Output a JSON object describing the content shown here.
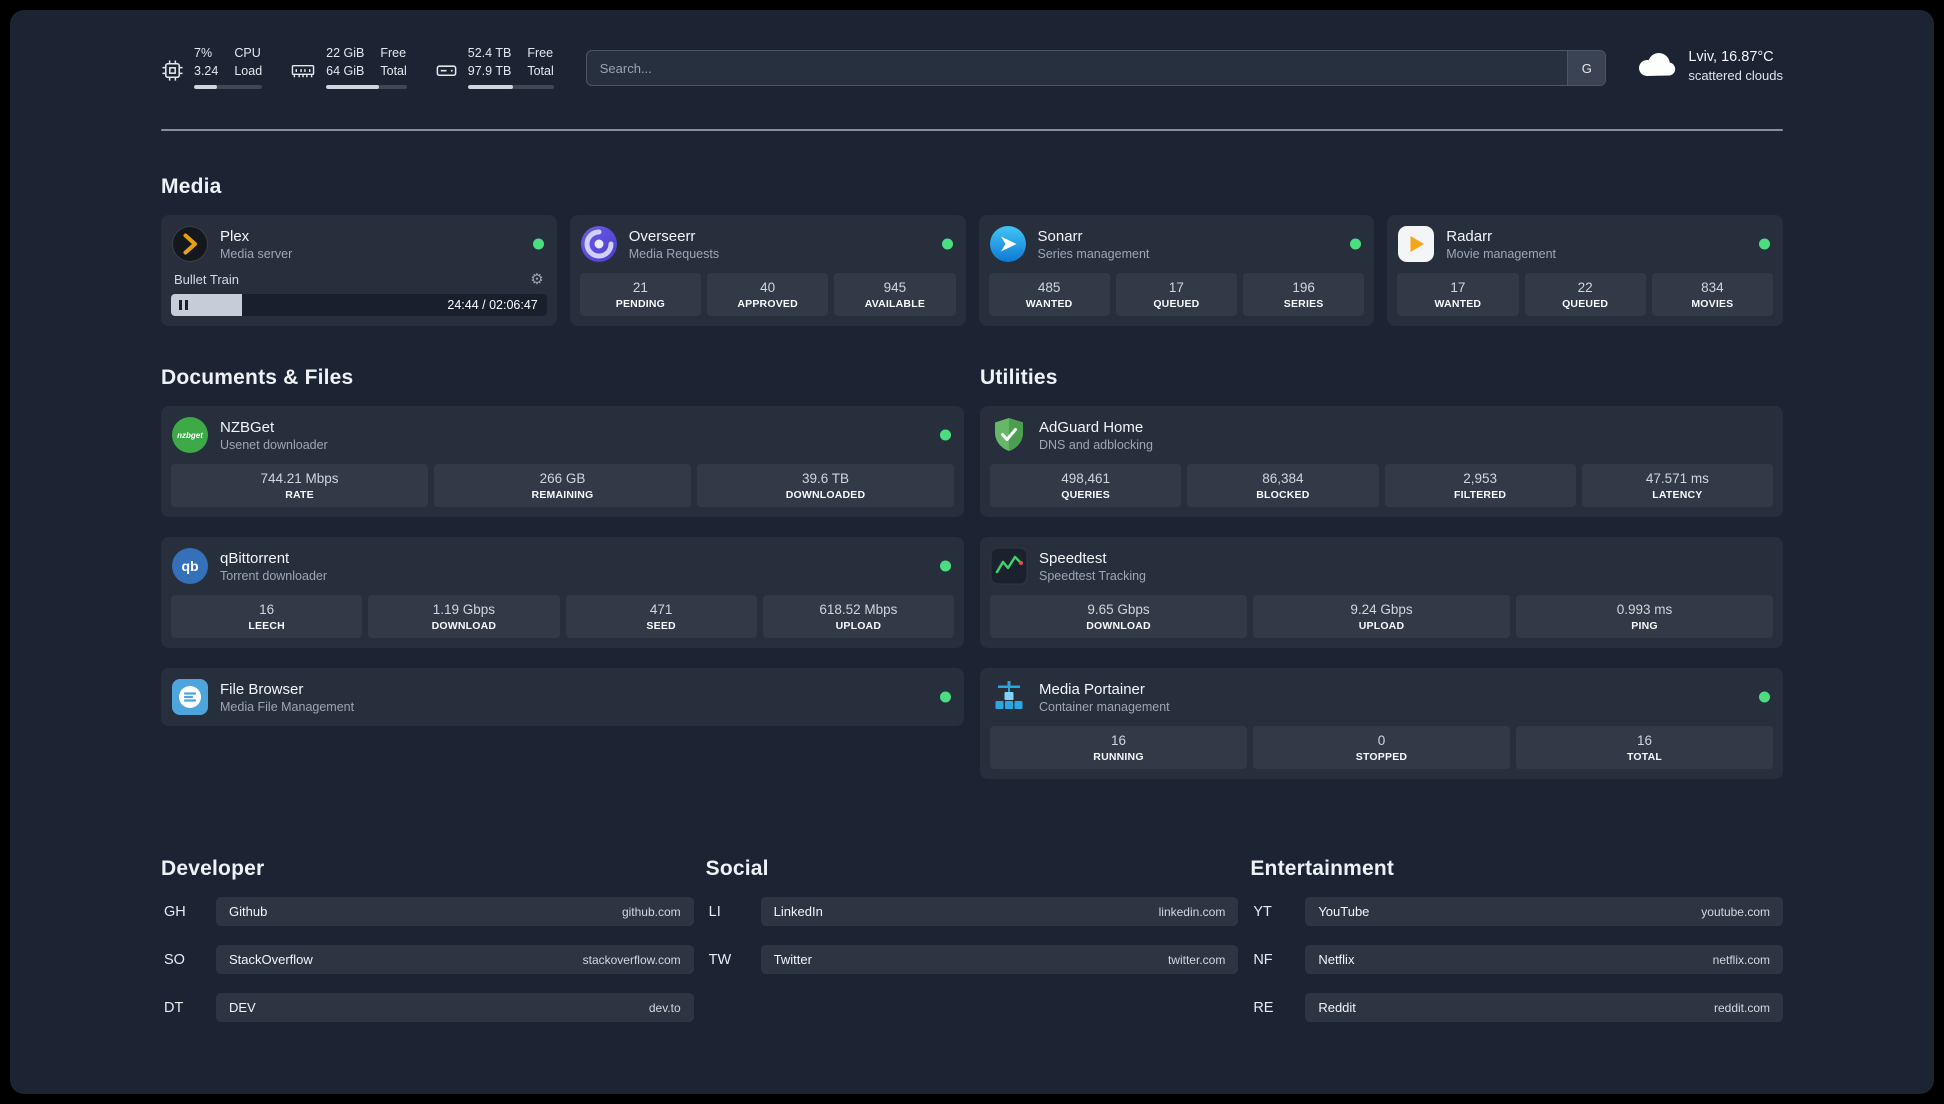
{
  "topbar": {
    "cpu": {
      "percent": "7%",
      "load": "3.24",
      "row1_label": "CPU",
      "row2_label": "Load",
      "bar_percent": 34
    },
    "memory": {
      "row1_value": "22 GiB",
      "row2_value": "64 GiB",
      "row1_label": "Free",
      "row2_label": "Total",
      "bar_percent": 66
    },
    "disk": {
      "row1_value": "52.4 TB",
      "row2_value": "97.9 TB",
      "row1_label": "Free",
      "row2_label": "Total",
      "bar_percent": 53
    },
    "search": {
      "placeholder": "Search...",
      "button_label": "G"
    },
    "weather": {
      "location": "Lviv, 16.87°C",
      "condition": "scattered clouds"
    }
  },
  "sections": {
    "media": "Media",
    "documents": "Documents & Files",
    "utilities": "Utilities",
    "developer": "Developer",
    "social": "Social",
    "entertainment": "Entertainment"
  },
  "services": {
    "plex": {
      "name": "Plex",
      "subtitle": "Media server",
      "now_playing": "Bullet Train",
      "time": "24:44 / 02:06:47",
      "progress_percent": 19
    },
    "overseerr": {
      "name": "Overseerr",
      "subtitle": "Media Requests",
      "stats": [
        {
          "value": "21",
          "label": "PENDING"
        },
        {
          "value": "40",
          "label": "APPROVED"
        },
        {
          "value": "945",
          "label": "AVAILABLE"
        }
      ]
    },
    "sonarr": {
      "name": "Sonarr",
      "subtitle": "Series management",
      "stats": [
        {
          "value": "485",
          "label": "WANTED"
        },
        {
          "value": "17",
          "label": "QUEUED"
        },
        {
          "value": "196",
          "label": "SERIES"
        }
      ]
    },
    "radarr": {
      "name": "Radarr",
      "subtitle": "Movie management",
      "stats": [
        {
          "value": "17",
          "label": "WANTED"
        },
        {
          "value": "22",
          "label": "QUEUED"
        },
        {
          "value": "834",
          "label": "MOVIES"
        }
      ]
    },
    "nzbget": {
      "name": "NZBGet",
      "subtitle": "Usenet downloader",
      "stats": [
        {
          "value": "744.21 Mbps",
          "label": "RATE"
        },
        {
          "value": "266 GB",
          "label": "REMAINING"
        },
        {
          "value": "39.6 TB",
          "label": "DOWNLOADED"
        }
      ]
    },
    "qbittorrent": {
      "name": "qBittorrent",
      "subtitle": "Torrent downloader",
      "stats": [
        {
          "value": "16",
          "label": "LEECH"
        },
        {
          "value": "1.19 Gbps",
          "label": "DOWNLOAD"
        },
        {
          "value": "471",
          "label": "SEED"
        },
        {
          "value": "618.52 Mbps",
          "label": "UPLOAD"
        }
      ]
    },
    "filebrowser": {
      "name": "File Browser",
      "subtitle": "Media File Management"
    },
    "adguard": {
      "name": "AdGuard Home",
      "subtitle": "DNS and adblocking",
      "stats": [
        {
          "value": "498,461",
          "label": "QUERIES"
        },
        {
          "value": "86,384",
          "label": "BLOCKED"
        },
        {
          "value": "2,953",
          "label": "FILTERED"
        },
        {
          "value": "47.571 ms",
          "label": "LATENCY"
        }
      ]
    },
    "speedtest": {
      "name": "Speedtest",
      "subtitle": "Speedtest Tracking",
      "stats": [
        {
          "value": "9.65 Gbps",
          "label": "DOWNLOAD"
        },
        {
          "value": "9.24 Gbps",
          "label": "UPLOAD"
        },
        {
          "value": "0.993 ms",
          "label": "PING"
        }
      ]
    },
    "portainer": {
      "name": "Media Portainer",
      "subtitle": "Container management",
      "stats": [
        {
          "value": "16",
          "label": "RUNNING"
        },
        {
          "value": "0",
          "label": "STOPPED"
        },
        {
          "value": "16",
          "label": "TOTAL"
        }
      ]
    }
  },
  "bookmarks": {
    "developer": [
      {
        "abbr": "GH",
        "name": "Github",
        "url": "github.com"
      },
      {
        "abbr": "SO",
        "name": "StackOverflow",
        "url": "stackoverflow.com"
      },
      {
        "abbr": "DT",
        "name": "DEV",
        "url": "dev.to"
      }
    ],
    "social": [
      {
        "abbr": "LI",
        "name": "LinkedIn",
        "url": "linkedin.com"
      },
      {
        "abbr": "TW",
        "name": "Twitter",
        "url": "twitter.com"
      }
    ],
    "entertainment": [
      {
        "abbr": "YT",
        "name": "YouTube",
        "url": "youtube.com"
      },
      {
        "abbr": "NF",
        "name": "Netflix",
        "url": "netflix.com"
      },
      {
        "abbr": "RE",
        "name": "Reddit",
        "url": "reddit.com"
      }
    ]
  },
  "colors": {
    "status_online": "#4ade80"
  }
}
